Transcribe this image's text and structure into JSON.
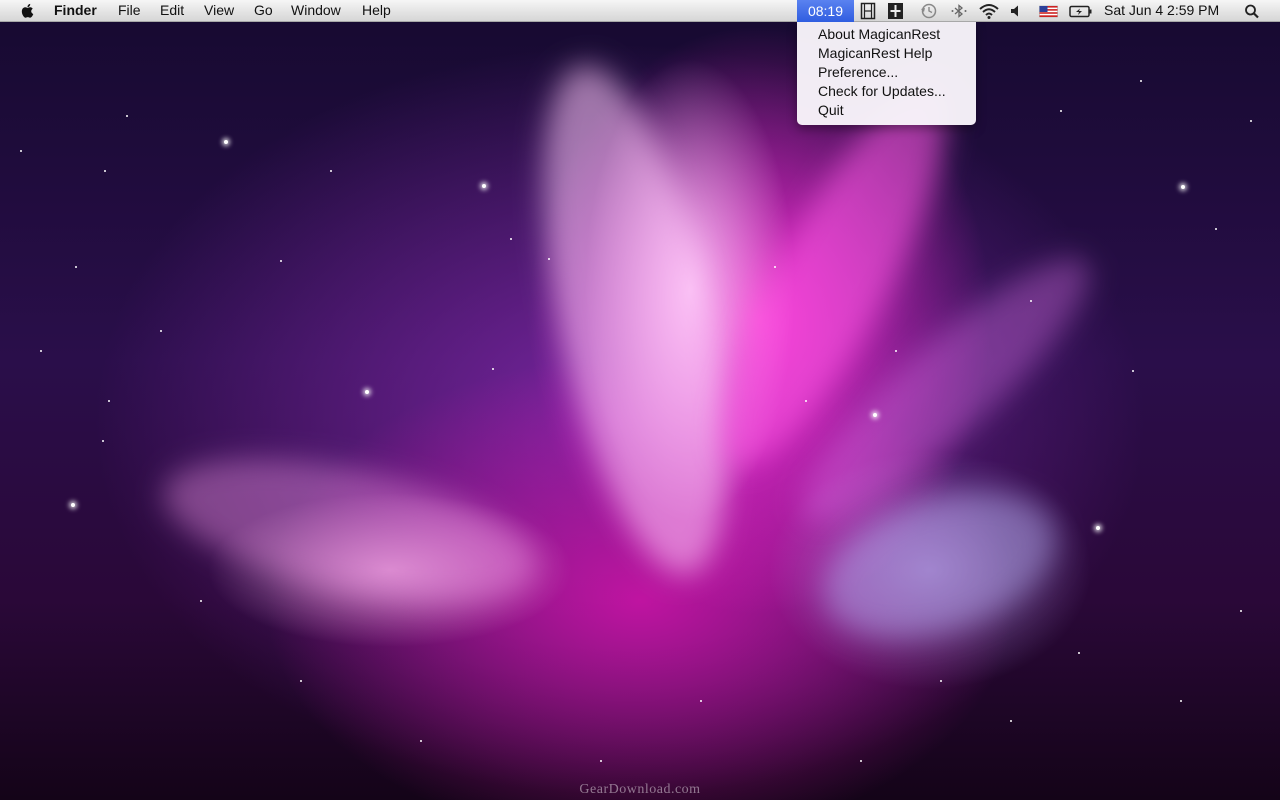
{
  "menubar": {
    "apple_icon": "apple-logo-icon",
    "app_name": "Finder",
    "menus": [
      "File",
      "Edit",
      "View",
      "Go",
      "Window",
      "Help"
    ],
    "status": {
      "timer": "08:19",
      "icons": [
        "film-strip-icon",
        "menulet-icon",
        "time-machine-icon",
        "bluetooth-icon",
        "wifi-icon",
        "volume-icon",
        "us-flag-icon",
        "battery-icon",
        "spotlight-search-icon"
      ],
      "clock": "Sat Jun 4  2:59 PM"
    }
  },
  "app_menu": {
    "items": [
      "About MagicanRest",
      "MagicanRest Help",
      "Preference...",
      "Check for Updates...",
      "Quit"
    ]
  },
  "watermark": "GearDownload.com",
  "colors": {
    "timer_highlight": "#3a66e8",
    "menubar": "#e6e6e6"
  }
}
